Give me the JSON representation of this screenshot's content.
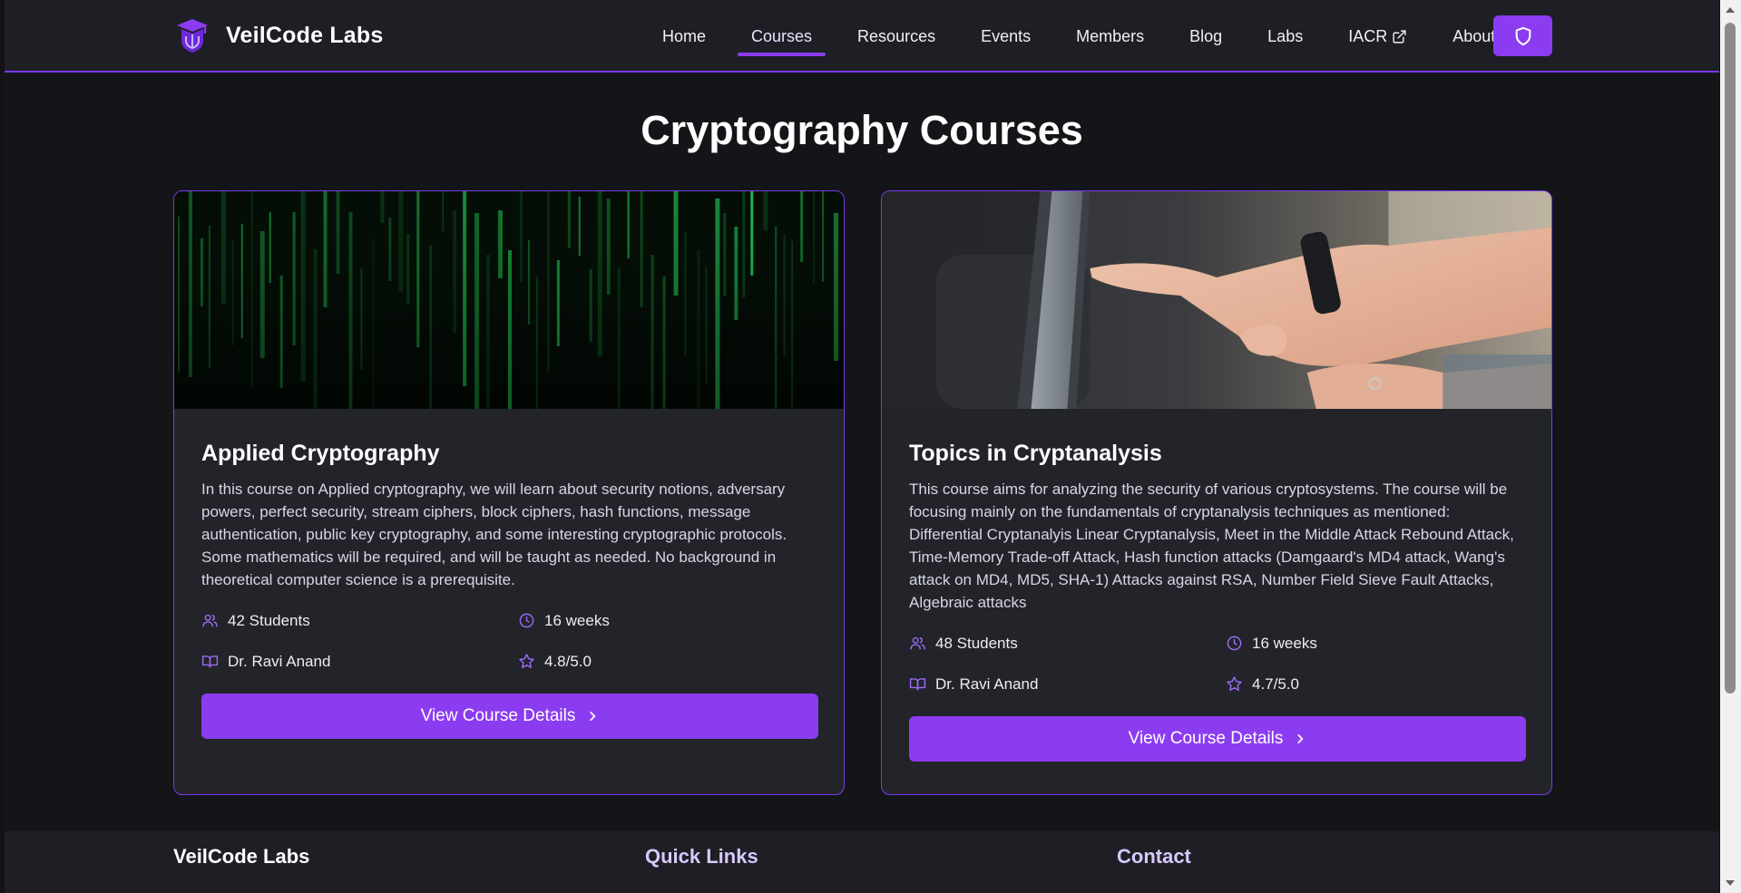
{
  "header": {
    "brand_name": "VeilCode Labs",
    "brand_icon": "graduation-shield-icon",
    "nav": [
      {
        "label": "Home",
        "active": false
      },
      {
        "label": "Courses",
        "active": true
      },
      {
        "label": "Resources",
        "active": false
      },
      {
        "label": "Events",
        "active": false
      },
      {
        "label": "Members",
        "active": false
      },
      {
        "label": "Blog",
        "active": false
      },
      {
        "label": "Labs",
        "active": false
      },
      {
        "label": "IACR",
        "active": false,
        "external": true
      },
      {
        "label": "About",
        "active": false
      }
    ],
    "action_icon": "shield-icon"
  },
  "main": {
    "title": "Cryptography Courses",
    "courses": [
      {
        "title": "Applied Cryptography",
        "image": "matrix-code-image",
        "description": "In this course on Applied cryptography, we will learn about security notions, adversary powers, perfect security, stream ciphers, block ciphers, hash functions, message authentication, public key cryptography, and some interesting cryptographic protocols. Some mathematics will be required, and will be taught as needed. No background in theoretical computer science is a prerequisite.",
        "students": "42 Students",
        "duration": "16 weeks",
        "instructor": "Dr. Ravi Anand",
        "rating": "4.8/5.0",
        "button_label": "View Course Details"
      },
      {
        "title": "Topics in Cryptanalysis",
        "image": "hand-pointing-laptop-image",
        "description": "This course aims for analyzing the security of various cryptosystems. The course will be focusing mainly on the fundamentals of cryptanalysis techniques as mentioned: Differential Cryptanalyis Linear Cryptanalysis, Meet in the Middle Attack Rebound Attack, Time-Memory Trade-off Attack, Hash function attacks (Damgaard's MD4 attack, Wang's attack on MD4, MD5, SHA-1) Attacks against RSA, Number Field Sieve Fault Attacks, Algebraic attacks",
        "students": "48 Students",
        "duration": "16 weeks",
        "instructor": "Dr. Ravi Anand",
        "rating": "4.7/5.0",
        "button_label": "View Course Details"
      }
    ]
  },
  "footer": {
    "brand": "VeilCode Labs",
    "quick_links_heading": "Quick Links",
    "contact_heading": "Contact"
  },
  "colors": {
    "accent": "#8b3cf0",
    "background": "#141518",
    "card": "#22242a",
    "header": "#1d1f24"
  }
}
